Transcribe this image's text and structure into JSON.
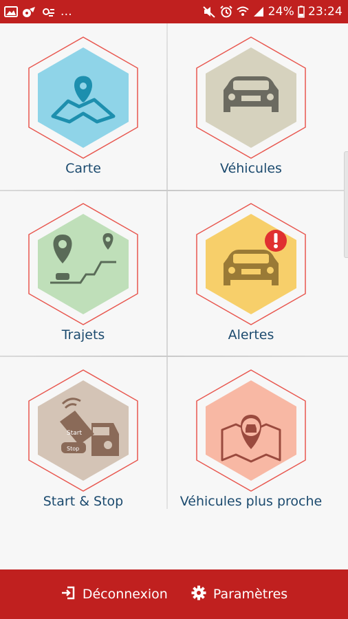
{
  "status_bar": {
    "overflow": "...",
    "battery": "24%",
    "time": "23:24",
    "icons": [
      "image-icon",
      "app-icon",
      "cloud-icon",
      "mute-icon",
      "alarm-icon",
      "wifi-icon",
      "signal-icon",
      "battery-icon"
    ]
  },
  "menu": {
    "items": [
      {
        "label": "Carte",
        "icon": "map-pin-icon",
        "color": "#8fd4e8"
      },
      {
        "label": "Véhicules",
        "icon": "car-icon",
        "color": "#d6d2be"
      },
      {
        "label": "Trajets",
        "icon": "route-icon",
        "color": "#bfdfb9"
      },
      {
        "label": "Alertes",
        "icon": "car-alert-icon",
        "color": "#f7cf6a"
      },
      {
        "label": "Start & Stop",
        "icon": "car-remote-icon",
        "color": "#d4c4b6"
      },
      {
        "label": "Véhicules plus proche",
        "icon": "nearby-car-icon",
        "color": "#f8b8a4"
      }
    ]
  },
  "bottom_bar": {
    "logout_label": "Déconnexion",
    "settings_label": "Paramètres"
  },
  "colors": {
    "brand_red": "#c0201f",
    "label_blue": "#1b4a6e",
    "hex_outline": "#e8574f"
  }
}
